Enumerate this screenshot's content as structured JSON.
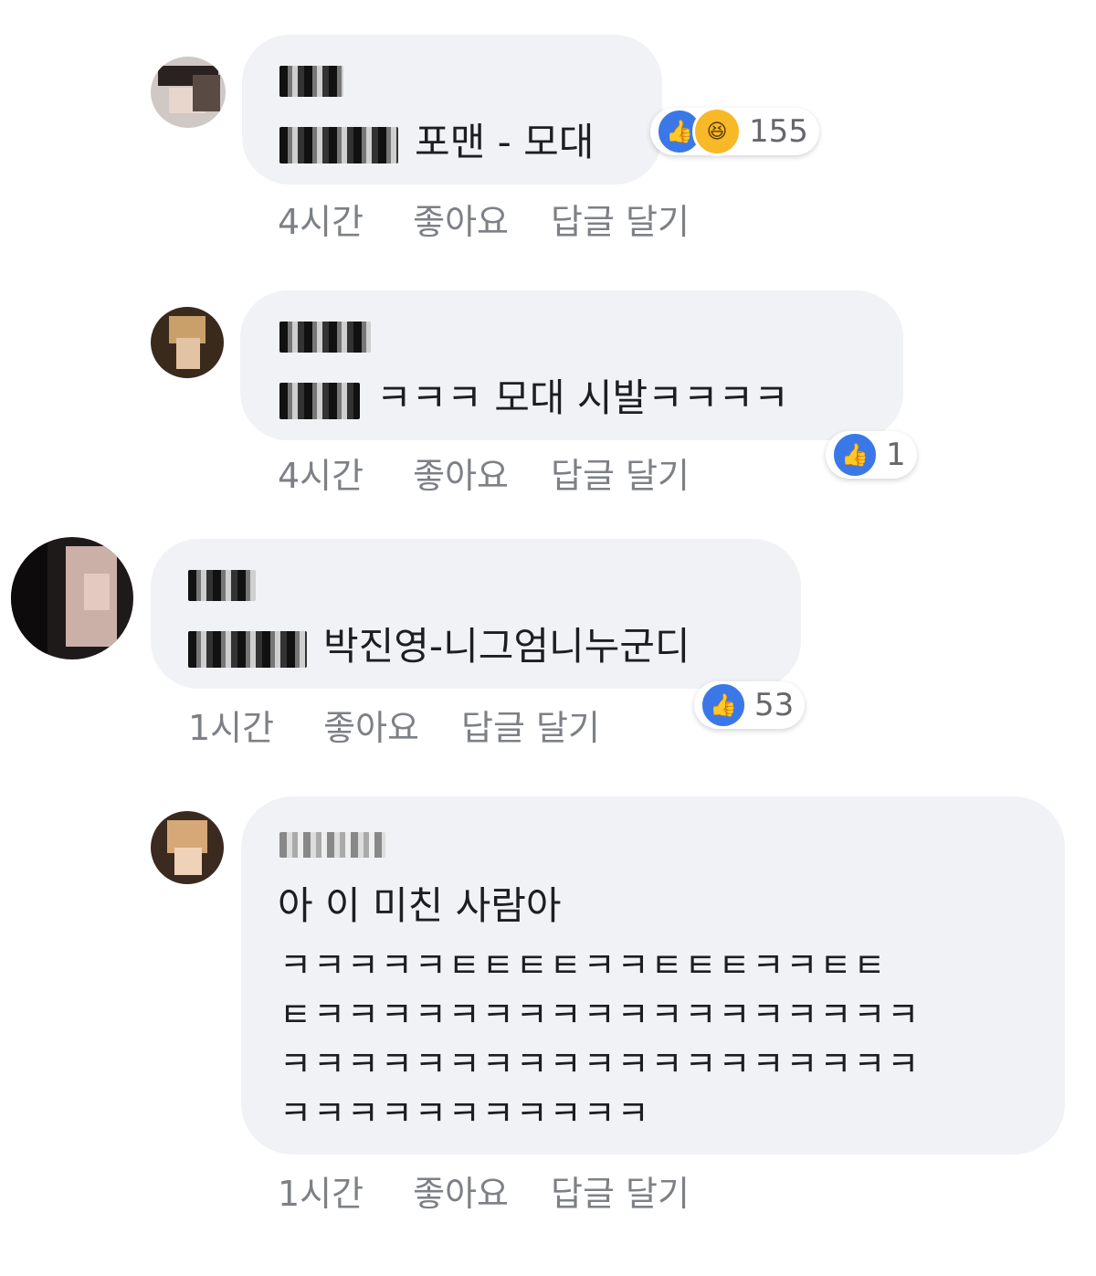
{
  "comments": [
    {
      "text": "포맨 - 모대",
      "time": "4시간",
      "like_label": "좋아요",
      "reply_label": "답글 달기",
      "reaction_count": "155",
      "reactions": [
        "like-icon",
        "haha-icon"
      ]
    },
    {
      "text": "ㅋㅋㅋ 모대 시발ㅋㅋㅋㅋ",
      "time": "4시간",
      "like_label": "좋아요",
      "reply_label": "답글 달기",
      "reaction_count": "1",
      "reactions": [
        "like-icon"
      ]
    },
    {
      "text": "박진영-니그엄니누군디",
      "time": "1시간",
      "like_label": "좋아요",
      "reply_label": "답글 달기",
      "reaction_count": "53",
      "reactions": [
        "like-icon"
      ]
    },
    {
      "text_line1": "아 이 미친 사람아",
      "text_line2": "ㅋㅋㅋㅋㅋㅌㅌㅌㅌㅋㅋㅌㅌㅌㅋㅋㅌㅌ",
      "text_line3": "ㅌㅋㅋㅋㅋㅋㅋㅋㅋㅋㅋㅋㅋㅋㅋㅋㅋㅋㅋ",
      "text_line4": "ㅋㅋㅋㅋㅋㅋㅋㅋㅋㅋㅋㅋㅋㅋㅋㅋㅋㅋㅋ",
      "text_line5": "ㅋㅋㅋㅋㅋㅋㅋㅋㅋㅋㅋ",
      "time": "1시간",
      "like_label": "좋아요",
      "reply_label": "답글 달기"
    }
  ],
  "colors": {
    "bubble": "#f0f2f5",
    "like_blue": "#3b78e7",
    "haha_yellow": "#f7b928",
    "meta_gray": "#7d8085"
  }
}
